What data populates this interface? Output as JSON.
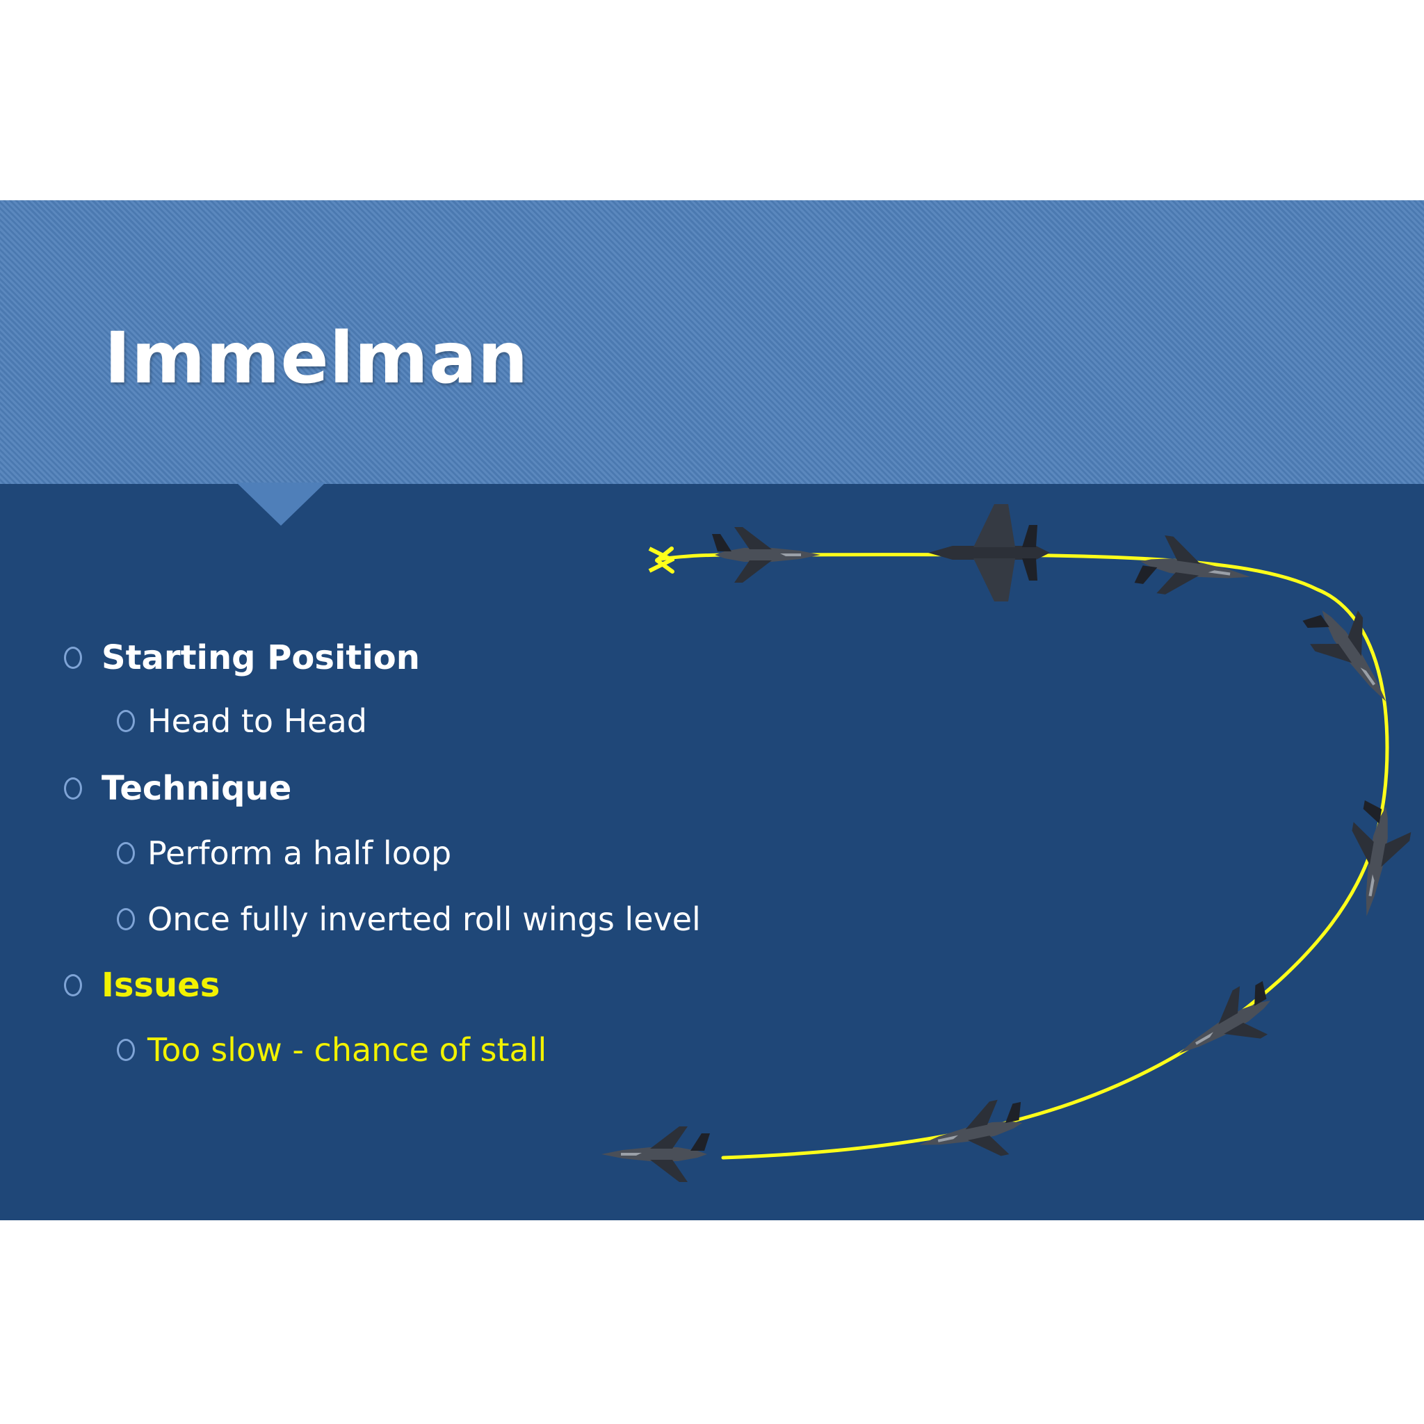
{
  "slide": {
    "title": "Immelman",
    "colors": {
      "background": "#1f4778",
      "title_band": "#4f7fb9",
      "text": "#ffffff",
      "highlight": "#f2f200",
      "path": "#ffff1a"
    },
    "bullets": [
      {
        "level": 1,
        "text": "Starting Position",
        "highlight": false
      },
      {
        "level": 2,
        "text": "Head to Head",
        "highlight": false
      },
      {
        "level": 1,
        "text": "Technique",
        "highlight": false
      },
      {
        "level": 2,
        "text": "Perform a half loop",
        "highlight": false
      },
      {
        "level": 2,
        "text": "Once fully inverted roll wings level",
        "highlight": false
      },
      {
        "level": 1,
        "text": "Issues",
        "highlight": true
      },
      {
        "level": 2,
        "text": "Too slow - chance of stall",
        "highlight": true
      }
    ]
  },
  "diagram": {
    "maneuver": "half loop then roll wings level",
    "path_direction": "exits to the left (arrowhead)",
    "aircraft_icons": [
      "fighter-jet-icon",
      "fighter-jet-icon",
      "fighter-jet-icon",
      "fighter-jet-icon",
      "fighter-jet-icon",
      "fighter-jet-icon",
      "fighter-jet-icon",
      "fighter-jet-icon"
    ]
  }
}
